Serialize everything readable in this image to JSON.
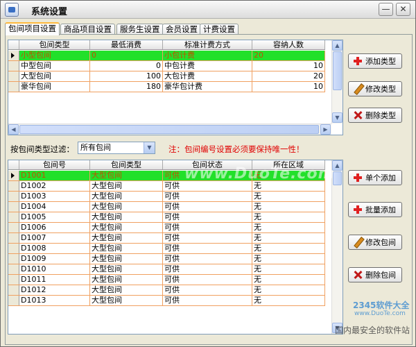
{
  "window": {
    "title": "系统设置"
  },
  "tabs": [
    "包间项目设置",
    "商品项目设置",
    "服务生设置",
    "会员设置",
    "计费设置"
  ],
  "type_grid": {
    "columns": [
      "包间类型",
      "最低消费",
      "标准计费方式",
      "容纳人数"
    ],
    "rows": [
      [
        "小型包间",
        "0",
        "小包计费",
        "20"
      ],
      [
        "中型包间",
        "0",
        "中包计费",
        "10"
      ],
      [
        "大型包间",
        "100",
        "大包计费",
        "20"
      ],
      [
        "豪华包间",
        "180",
        "豪华包计费",
        "10"
      ]
    ],
    "selected_row": 0
  },
  "type_buttons": {
    "add": "添加类型",
    "edit": "修改类型",
    "delete": "删除类型"
  },
  "filter": {
    "label": "按包间类型过滤：",
    "value": "所有包间"
  },
  "note": "注：包间编号设置必须要保持唯一性！",
  "room_grid": {
    "columns": [
      "包间号",
      "包间类型",
      "包间状态",
      "所在区域"
    ],
    "rows": [
      [
        "D1001",
        "大型包间",
        "可供",
        "无"
      ],
      [
        "D1002",
        "大型包间",
        "可供",
        "无"
      ],
      [
        "D1003",
        "大型包间",
        "可供",
        "无"
      ],
      [
        "D1004",
        "大型包间",
        "可供",
        "无"
      ],
      [
        "D1005",
        "大型包间",
        "可供",
        "无"
      ],
      [
        "D1006",
        "大型包间",
        "可供",
        "无"
      ],
      [
        "D1007",
        "大型包间",
        "可供",
        "无"
      ],
      [
        "D1008",
        "大型包间",
        "可供",
        "无"
      ],
      [
        "D1009",
        "大型包间",
        "可供",
        "无"
      ],
      [
        "D1010",
        "大型包间",
        "可供",
        "无"
      ],
      [
        "D1011",
        "大型包间",
        "可供",
        "无"
      ],
      [
        "D1012",
        "大型包间",
        "可供",
        "无"
      ],
      [
        "D1013",
        "大型包间",
        "可供",
        "无"
      ]
    ],
    "selected_row": 0
  },
  "room_buttons": {
    "single_add": "单个添加",
    "batch_add": "批量添加",
    "edit": "修改包间",
    "delete": "删除包间"
  },
  "watermarks": {
    "center": "www.DuoTe.com",
    "logo": "2345软件大全",
    "logo_sub": "www.DuoTe.com",
    "foot": "国内最安全的软件站"
  },
  "colors": {
    "selected_row": "#22e02a",
    "grid_line": "#f0a060",
    "note": "#e00000",
    "accent_tab": "#ffb83b"
  }
}
